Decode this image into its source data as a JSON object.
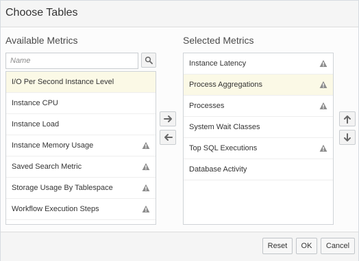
{
  "dialog": {
    "title": "Choose Tables"
  },
  "available": {
    "label": "Available Metrics",
    "search_placeholder": "Name",
    "search_value": "",
    "items": [
      {
        "label": "I/O Per Second Instance Level",
        "warning": false,
        "selected": true
      },
      {
        "label": "Instance CPU",
        "warning": false,
        "selected": false
      },
      {
        "label": "Instance Load",
        "warning": false,
        "selected": false
      },
      {
        "label": "Instance Memory Usage",
        "warning": true,
        "selected": false
      },
      {
        "label": "Saved Search Metric",
        "warning": true,
        "selected": false
      },
      {
        "label": "Storage Usage By Tablespace",
        "warning": true,
        "selected": false
      },
      {
        "label": "Workflow Execution Steps",
        "warning": true,
        "selected": false
      }
    ]
  },
  "selected": {
    "label": "Selected Metrics",
    "items": [
      {
        "label": "Instance Latency",
        "warning": true,
        "selected": false
      },
      {
        "label": "Process Aggregations",
        "warning": true,
        "selected": true
      },
      {
        "label": "Processes",
        "warning": true,
        "selected": false
      },
      {
        "label": "System Wait Classes",
        "warning": false,
        "selected": false
      },
      {
        "label": "Top SQL Executions",
        "warning": true,
        "selected": false
      },
      {
        "label": "Database Activity",
        "warning": false,
        "selected": false
      }
    ]
  },
  "icons": {
    "search": "search-icon",
    "move_right": "arrow-right-icon",
    "move_left": "arrow-left-icon",
    "move_up": "arrow-up-icon",
    "move_down": "arrow-down-icon",
    "warning": "warning-triangle-icon"
  },
  "colors": {
    "selected_row_bg": "#fbf9e6",
    "icon_gray": "#8c8c8c"
  },
  "footer": {
    "reset_label": "Reset",
    "ok_label": "OK",
    "cancel_label": "Cancel"
  }
}
